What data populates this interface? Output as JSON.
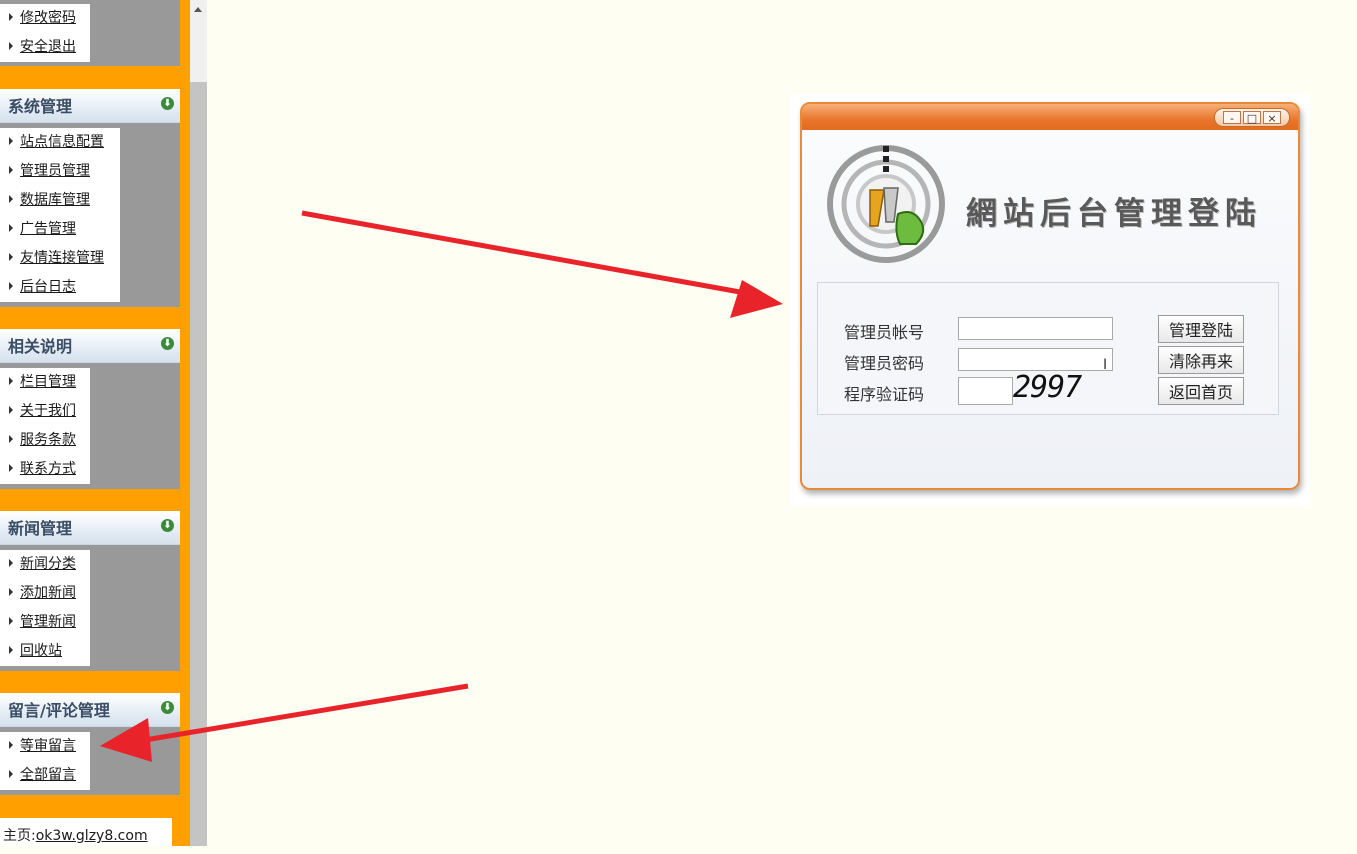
{
  "sidebar": {
    "top_items": [
      {
        "label": "修改密码"
      },
      {
        "label": "安全退出"
      }
    ],
    "groups": [
      {
        "title": "系统管理",
        "items": [
          {
            "label": "站点信息配置"
          },
          {
            "label": "管理员管理"
          },
          {
            "label": "数据库管理"
          },
          {
            "label": "广告管理"
          },
          {
            "label": "友情连接管理"
          },
          {
            "label": "后台日志"
          }
        ]
      },
      {
        "title": "相关说明",
        "items": [
          {
            "label": "栏目管理"
          },
          {
            "label": "关于我们"
          },
          {
            "label": "服务条款"
          },
          {
            "label": "联系方式"
          }
        ]
      },
      {
        "title": "新闻管理",
        "items": [
          {
            "label": "新闻分类"
          },
          {
            "label": "添加新闻"
          },
          {
            "label": "管理新闻"
          },
          {
            "label": "回收站"
          }
        ]
      },
      {
        "title": "留言/评论管理",
        "items": [
          {
            "label": "等审留言"
          },
          {
            "label": "全部留言"
          }
        ]
      }
    ],
    "footer": {
      "prefix": "主页:",
      "link": "ok3w.glzy8.com"
    }
  },
  "login": {
    "title": "網站后台管理登陆",
    "fields": {
      "username_label": "管理员帐号",
      "username_value": "",
      "password_label": "管理员密码",
      "password_value": "",
      "captcha_label": "程序验证码",
      "captcha_value": "",
      "captcha_image_text": "2997"
    },
    "buttons": {
      "login": "管理登陆",
      "clear": "清除再来",
      "home": "返回首页"
    },
    "window_controls": {
      "minimize": "-",
      "maximize": "□",
      "close": "×"
    }
  },
  "annotations": {
    "arrow_color": "#e8242a"
  }
}
